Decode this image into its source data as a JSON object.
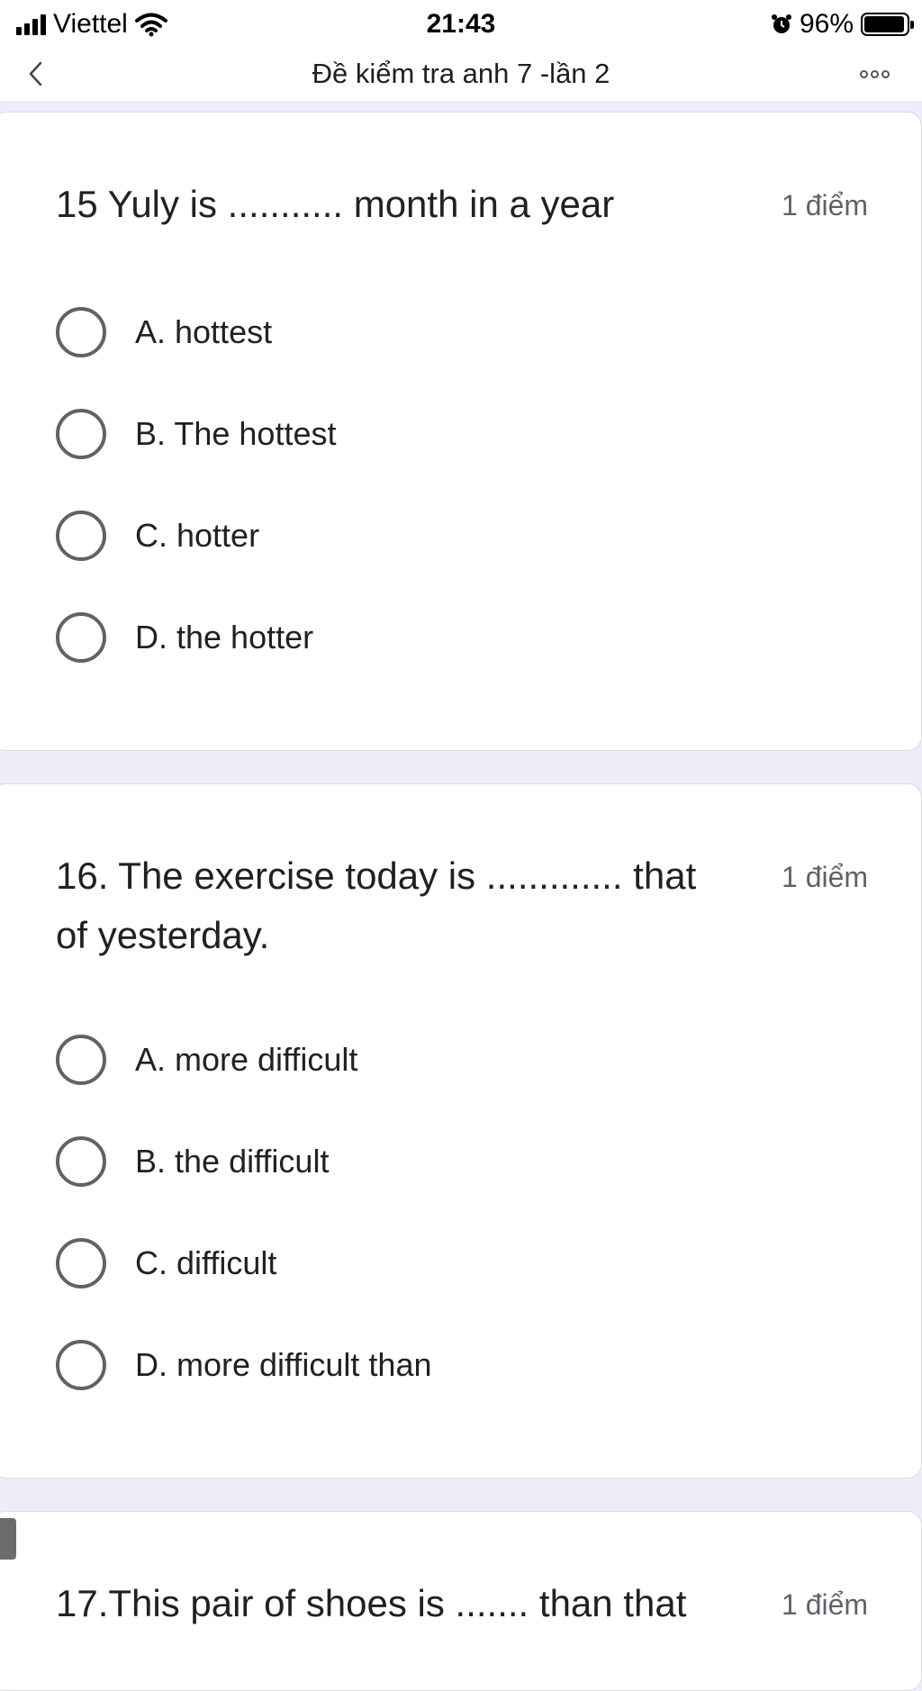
{
  "status_bar": {
    "carrier": "Viettel",
    "time": "21:43",
    "battery_percent": "96%",
    "battery_level": 0.96
  },
  "nav": {
    "title": "Đề kiểm tra anh 7 -lần 2"
  },
  "questions": [
    {
      "title": "15 Yuly is ........... month in a year",
      "points": "1 điểm",
      "options": [
        "A. hottest",
        "B. The hottest",
        "C. hotter",
        "D. the hotter"
      ]
    },
    {
      "title": "16. The exercise today is ............. that of yesterday.",
      "points": "1 điểm",
      "options": [
        "A. more difficult",
        "B. the difficult",
        "C. difficult",
        "D. more difficult than"
      ]
    },
    {
      "title": "17.This pair of shoes is ....... than that",
      "points": "1 điểm",
      "options": []
    }
  ],
  "colors": {
    "page_background": "#f0ebf8",
    "card_background": "#ffffff",
    "radio_border": "#5f6368",
    "points_text": "#5f6368"
  }
}
